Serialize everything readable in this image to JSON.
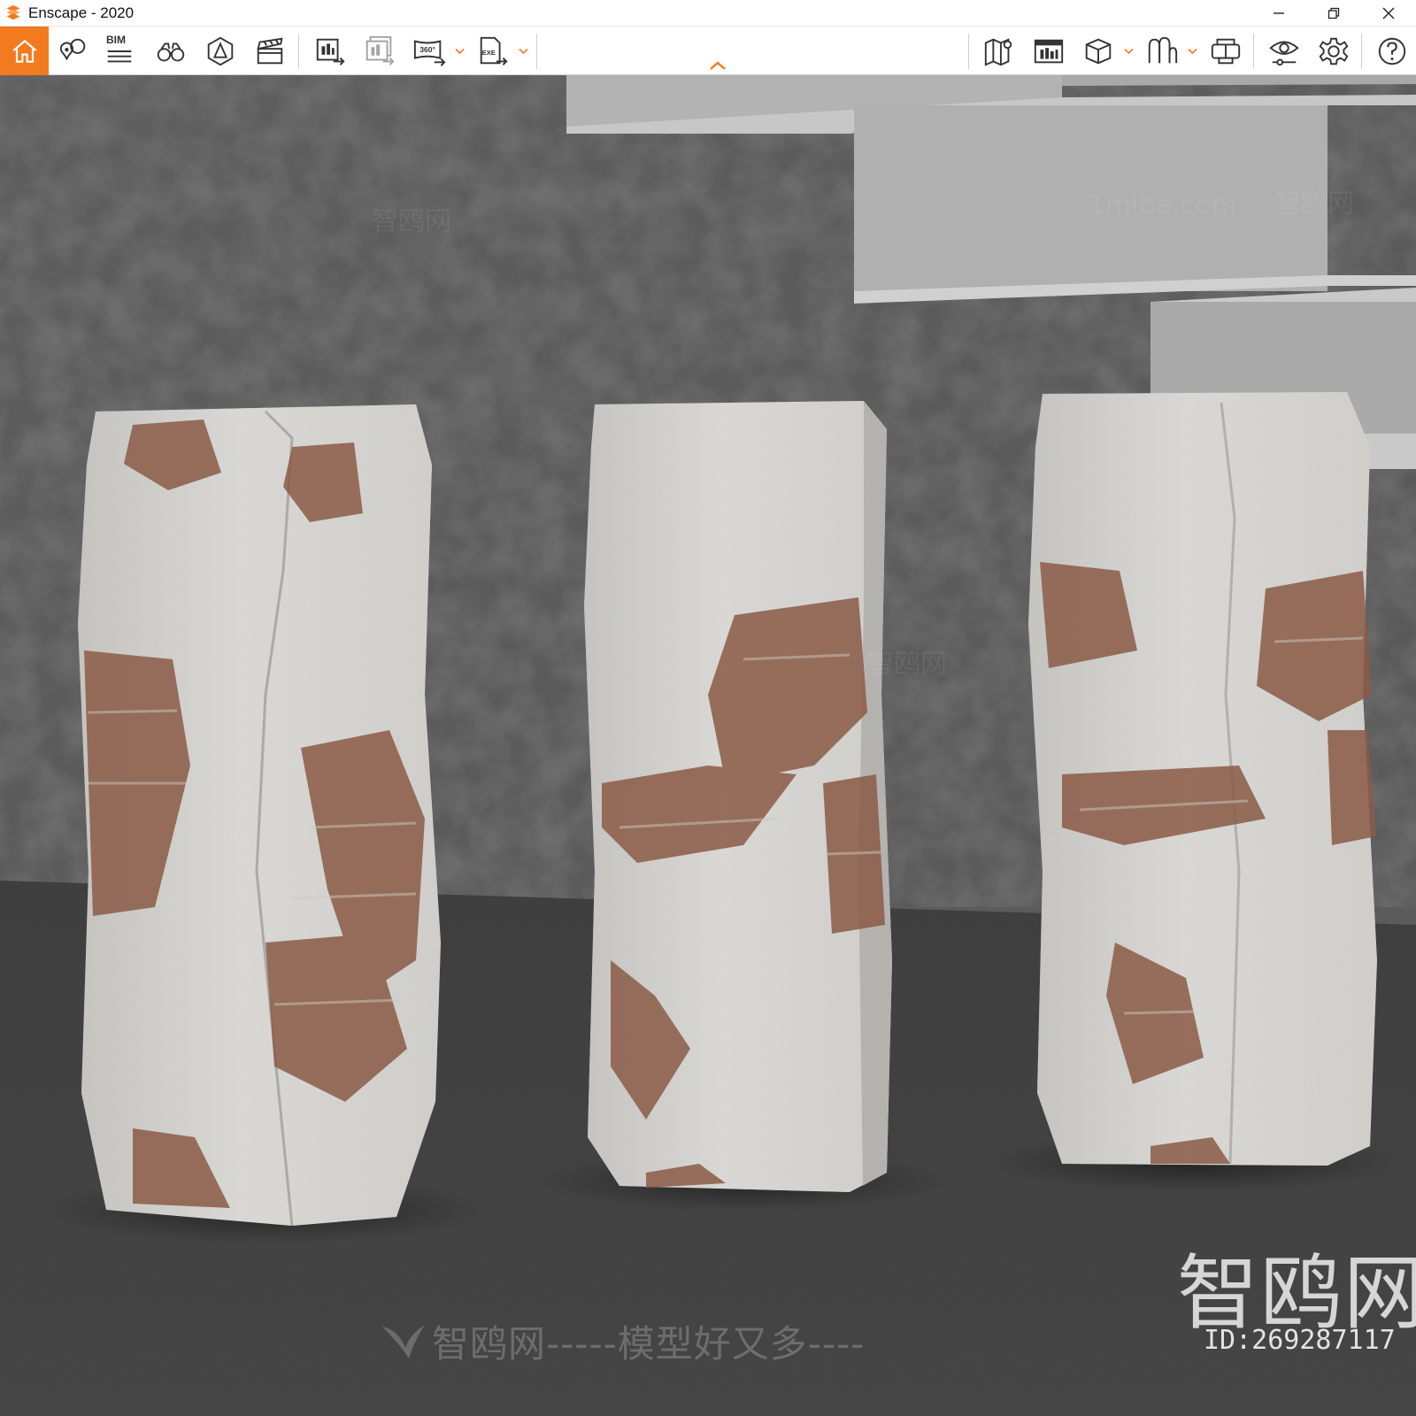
{
  "window": {
    "title": "Enscape - 2020"
  },
  "toolbar": {
    "bim_label": "BIM",
    "panorama_label": "360°",
    "exe_label": "EXE"
  },
  "watermarks": {
    "slogan": "智鸥网-----模型好又多----",
    "brand": "智鸥网",
    "id_text": "ID:269287117",
    "site": "1miba.com"
  },
  "colors": {
    "accent": "#f47a20",
    "toolbar_bg": "#ffffff",
    "icon": "#333333"
  },
  "icons": {
    "home": "home-icon",
    "pin": "pin-icon",
    "bim": "bim-list-icon",
    "binoculars": "binoculars-icon",
    "atmosphere": "atmosphere-icon",
    "clapper": "clapperboard-icon",
    "screenshot": "screenshot-export-icon",
    "batch": "batch-render-icon",
    "panorama": "panorama-360-icon",
    "exe": "exe-export-icon",
    "map": "map-icon",
    "views": "views-manager-icon",
    "cube": "cube-icon",
    "assets": "asset-library-icon",
    "vr": "vr-headset-icon",
    "visual": "visual-settings-icon",
    "settings": "gear-icon",
    "help": "help-icon"
  }
}
